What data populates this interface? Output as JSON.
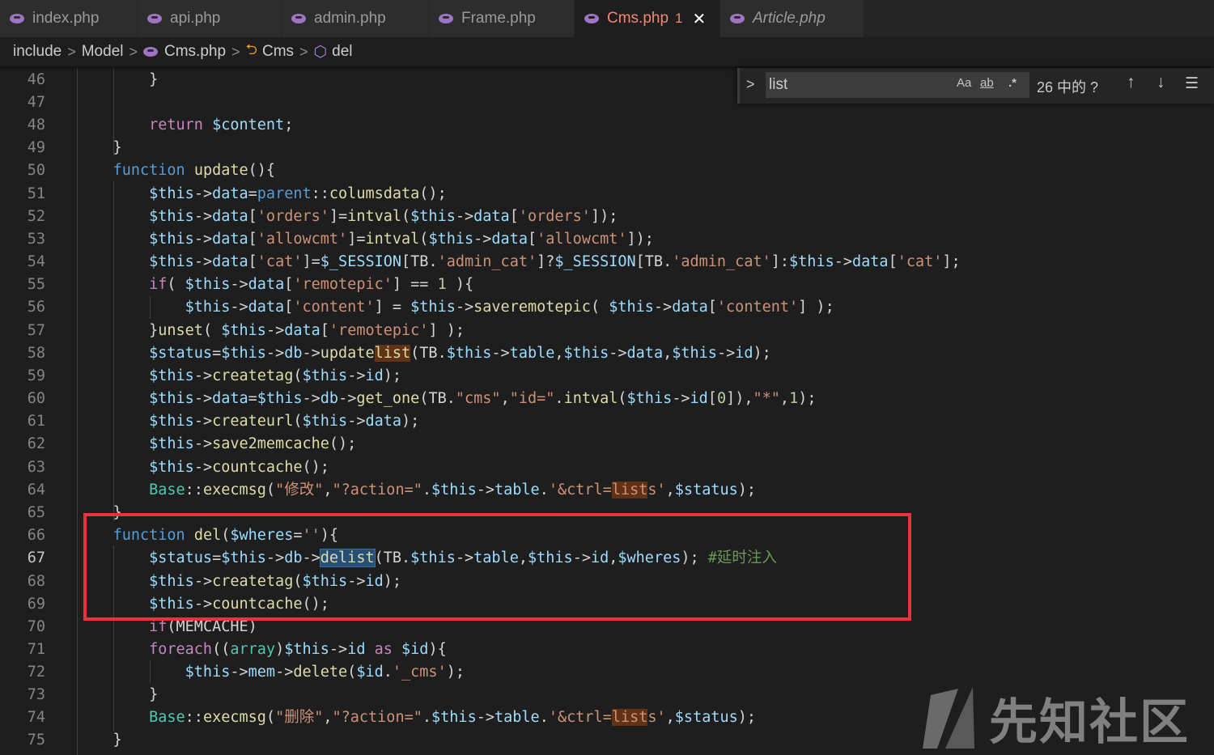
{
  "tabs": [
    {
      "label": "index.php",
      "active": false,
      "italic": false
    },
    {
      "label": "api.php",
      "active": false,
      "italic": false
    },
    {
      "label": "admin.php",
      "active": false,
      "italic": false
    },
    {
      "label": "Frame.php",
      "active": false,
      "italic": false
    },
    {
      "label": "Cms.php",
      "active": true,
      "italic": false,
      "badge": "1",
      "close": "✕"
    },
    {
      "label": "Article.php",
      "active": false,
      "italic": true
    }
  ],
  "breadcrumb": {
    "items": [
      "include",
      "Model",
      "Cms.php",
      "Cms",
      "del"
    ],
    "separator": ">"
  },
  "find": {
    "value": "list",
    "opt_case": "Aa",
    "opt_word": "ab",
    "opt_regex": ".*",
    "count": "26 中的 ?",
    "prev": "↑",
    "next": "↓",
    "menu": "☰",
    "toggle": ">"
  },
  "code": {
    "line_numbers": [
      "46",
      "47",
      "48",
      "49",
      "50",
      "51",
      "52",
      "53",
      "54",
      "55",
      "56",
      "57",
      "58",
      "59",
      "60",
      "61",
      "62",
      "63",
      "64",
      "65",
      "66",
      "67",
      "68",
      "69",
      "70",
      "71",
      "72",
      "73",
      "74",
      "75"
    ],
    "current_line": "67"
  },
  "watermark": {
    "text": "先知社区"
  },
  "colors": {
    "annotation_box": "#e8323c",
    "active_tab": "#f48771",
    "keyword": "#569cd6",
    "variable": "#9cdcfe",
    "string": "#ce9178",
    "function": "#dcdcaa",
    "comment": "#6a9955"
  }
}
